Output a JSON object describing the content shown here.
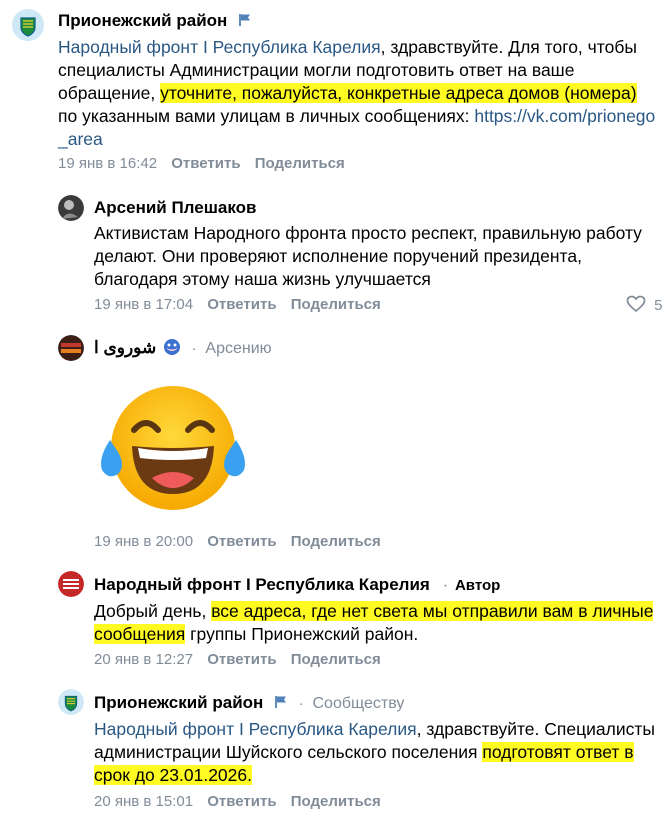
{
  "comments": [
    {
      "author": "Прионежский район",
      "text_parts": [
        "Народный фронт I Республика Карелия",
        ", здравствуйте. Для того, чтобы специалисты Администрации могли подготовить ответ на ваше обращение, ",
        "уточните, пожалуйста, конкретные адреса домов (номера)",
        " по указанным вами улицам в личных сообщениях: ",
        "https://vk.com/prionego_area"
      ],
      "date": "19 янв в 16:42",
      "reply_label": "Ответить",
      "share_label": "Поделиться"
    },
    {
      "author": "Арсений Плешаков",
      "text": "Активистам Народного фронта просто респект, правильную работу делают. Они проверяют исполнение поручений президента, благодаря этому наша жизнь улучшается",
      "date": "19 янв в 17:04",
      "reply_label": "Ответить",
      "share_label": "Поделиться",
      "likes": "5"
    },
    {
      "author": "شوروی ا",
      "reply_to": "Арсению",
      "date": "19 янв в 20:00",
      "reply_label": "Ответить",
      "share_label": "Поделиться",
      "sticker": "laughing-crying-emoji"
    },
    {
      "author": "Народный фронт I Республика Карелия",
      "badge": "Автор",
      "text_parts": [
        "Добрый день, ",
        "все адреса, где нет света мы отправили вам в личные сообщения",
        " группы Прионежский район."
      ],
      "date": "20 янв в 12:27",
      "reply_label": "Ответить",
      "share_label": "Поделиться"
    },
    {
      "author": "Прионежский район",
      "reply_to": "Сообществу",
      "text_parts": [
        "Народный фронт I Республика Карелия",
        ", здравствуйте. Специалисты администрации Шуйского сельского поселения ",
        "подготовят ответ в срок до 23.01.2026."
      ],
      "date": "20 янв в 15:01",
      "reply_label": "Ответить",
      "share_label": "Поделиться"
    }
  ],
  "colors": {
    "link": "#2a5885",
    "meta": "#818c99",
    "highlight": "#fffb22"
  }
}
